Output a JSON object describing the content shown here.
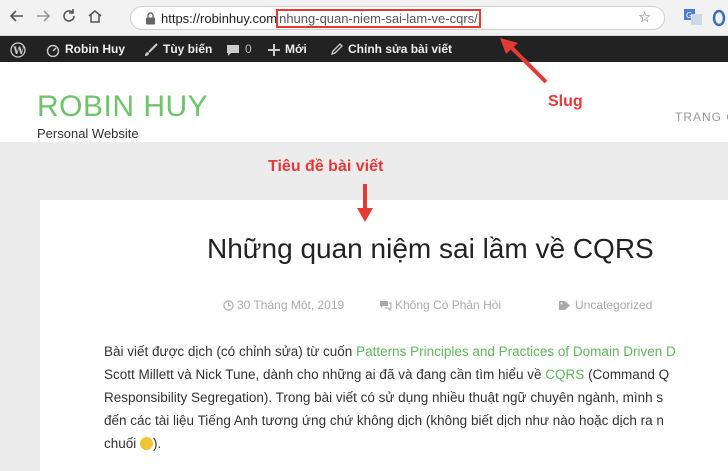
{
  "browser": {
    "back_icon": "arrow-left-icon",
    "forward_icon": "arrow-right-icon",
    "reload_icon": "reload-icon",
    "home_icon": "home-icon",
    "url_host": "https://robinhuy.com",
    "url_path": "nhung-quan-niem-sai-lam-ve-cqrs",
    "url_trailing": "/"
  },
  "admin_bar": {
    "site_name": "Robin Huy",
    "customize": "Tùy biến",
    "comments_count": "0",
    "new": "Mới",
    "edit_post": "Chỉnh sửa bài viết"
  },
  "site": {
    "title": "ROBIN HUY",
    "description": "Personal Website",
    "nav_home": "TRANG C"
  },
  "annotations": {
    "slug": "Slug",
    "post_title_note": "Tiêu đề bài viết",
    "color": "#e53935"
  },
  "post": {
    "title": "Những quan niệm sai lầm về CQRS",
    "date": "30 Tháng Một, 2019",
    "comments": "Không Có Phản Hồi",
    "category": "Uncategorized",
    "body": {
      "l1_a": "Bài viết được dịch (có chỉnh sửa) từ cuốn ",
      "l1_link": "Patterns Principles and Practices of Domain Driven D",
      "l2_a": "Scott Millett và Nick Tune, dành cho những ai đã và đang cần tìm hiểu về ",
      "l2_link": "CQRS",
      "l2_b": " (Command Q",
      "l3": "Responsibility Segregation). Trong bài viết có sử dụng nhiều thuật ngữ chuyên ngành, mình s",
      "l4": "đến các tài liệu Tiếng Anh tương ứng chứ không dịch (không biết dịch như nào hoặc dịch ra n",
      "l5_a": "chuối ",
      "l5_b": ")."
    }
  },
  "colors": {
    "brand_green": "#6fc36b",
    "admin_bar": "#222222",
    "annotation_red": "#e53935"
  }
}
